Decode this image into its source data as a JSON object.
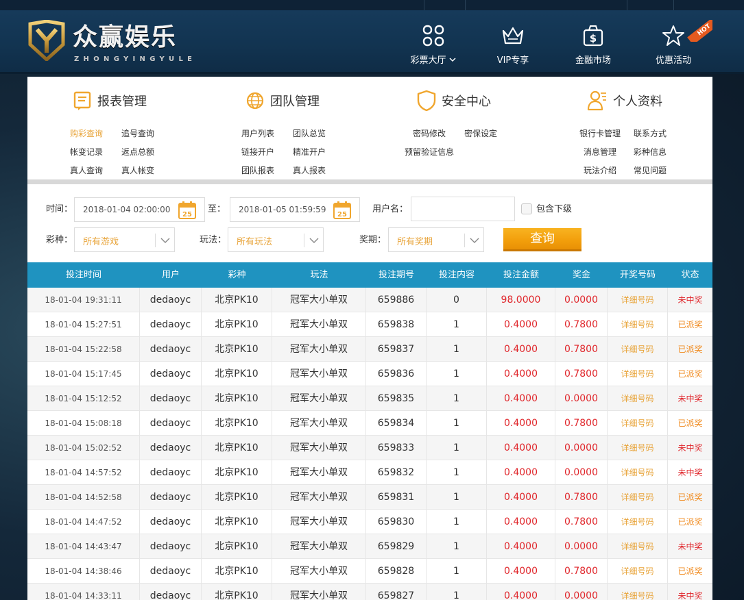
{
  "header": {
    "brand": "众赢娱乐",
    "brand_pinyin": "ZHONGYINGYULE",
    "nav": [
      {
        "label": "彩票大厅",
        "icon": "grid-icon",
        "has_dropdown": true
      },
      {
        "label": "VIP专享",
        "icon": "crown-icon"
      },
      {
        "label": "金融市场",
        "icon": "money-bag-icon"
      },
      {
        "label": "优惠活动",
        "icon": "star-icon"
      }
    ],
    "hot_badge": "HOT"
  },
  "menus": [
    {
      "title": "报表管理",
      "icon": "report-icon",
      "links": [
        "购彩查询",
        "追号查询",
        "帐变记录",
        "返点总额",
        "真人查询",
        "真人帐变"
      ],
      "active": "购彩查询"
    },
    {
      "title": "团队管理",
      "icon": "globe-icon",
      "links": [
        "用户列表",
        "团队总览",
        "链接开户",
        "精准开户",
        "团队报表",
        "真人报表"
      ]
    },
    {
      "title": "安全中心",
      "icon": "shield-icon",
      "links": [
        "密码修改",
        "密保设定",
        "预留验证信息"
      ]
    },
    {
      "title": "个人资料",
      "icon": "user-icon",
      "links": [
        "银行卡管理",
        "联系方式",
        "消息管理",
        "彩种信息",
        "玩法介绍",
        "常见问题"
      ]
    }
  ],
  "filter": {
    "time_label": "时间：",
    "start_time": "2018-01-04 02:00:00",
    "to_label": "至：",
    "end_time": "2018-01-05 01:59:59",
    "calendar_day": "25",
    "username_label": "用户名：",
    "username_value": "",
    "include_sub_label": "包含下级",
    "game_label": "彩种：",
    "game_value": "所有游戏",
    "play_label": "玩法：",
    "play_value": "所有玩法",
    "prize_label": "奖期：",
    "prize_value": "所有奖期",
    "query_label": "查询"
  },
  "table": {
    "headers": [
      "投注时间",
      "用户",
      "彩种",
      "玩法",
      "投注期号",
      "投注内容",
      "投注金额",
      "奖金",
      "开奖号码",
      "状态"
    ],
    "rows": [
      [
        "18-01-04 19:31:11",
        "dedaoyc",
        "北京PK10",
        "冠军大小单双",
        "659886",
        "0",
        "98.0000",
        "0.0000",
        "详细号码",
        "未中奖"
      ],
      [
        "18-01-04 15:27:51",
        "dedaoyc",
        "北京PK10",
        "冠军大小单双",
        "659838",
        "1",
        "0.4000",
        "0.7800",
        "详细号码",
        "已派奖"
      ],
      [
        "18-01-04 15:22:58",
        "dedaoyc",
        "北京PK10",
        "冠军大小单双",
        "659837",
        "1",
        "0.4000",
        "0.7800",
        "详细号码",
        "已派奖"
      ],
      [
        "18-01-04 15:17:45",
        "dedaoyc",
        "北京PK10",
        "冠军大小单双",
        "659836",
        "1",
        "0.4000",
        "0.7800",
        "详细号码",
        "已派奖"
      ],
      [
        "18-01-04 15:12:52",
        "dedaoyc",
        "北京PK10",
        "冠军大小单双",
        "659835",
        "1",
        "0.4000",
        "0.0000",
        "详细号码",
        "未中奖"
      ],
      [
        "18-01-04 15:08:18",
        "dedaoyc",
        "北京PK10",
        "冠军大小单双",
        "659834",
        "1",
        "0.4000",
        "0.7800",
        "详细号码",
        "已派奖"
      ],
      [
        "18-01-04 15:02:52",
        "dedaoyc",
        "北京PK10",
        "冠军大小单双",
        "659833",
        "1",
        "0.4000",
        "0.0000",
        "详细号码",
        "未中奖"
      ],
      [
        "18-01-04 14:57:52",
        "dedaoyc",
        "北京PK10",
        "冠军大小单双",
        "659832",
        "1",
        "0.4000",
        "0.0000",
        "详细号码",
        "未中奖"
      ],
      [
        "18-01-04 14:52:58",
        "dedaoyc",
        "北京PK10",
        "冠军大小单双",
        "659831",
        "1",
        "0.4000",
        "0.7800",
        "详细号码",
        "已派奖"
      ],
      [
        "18-01-04 14:47:52",
        "dedaoyc",
        "北京PK10",
        "冠军大小单双",
        "659830",
        "1",
        "0.4000",
        "0.7800",
        "详细号码",
        "已派奖"
      ],
      [
        "18-01-04 14:43:47",
        "dedaoyc",
        "北京PK10",
        "冠军大小单双",
        "659829",
        "1",
        "0.4000",
        "0.0000",
        "详细号码",
        "未中奖"
      ],
      [
        "18-01-04 14:38:46",
        "dedaoyc",
        "北京PK10",
        "冠军大小单双",
        "659828",
        "1",
        "0.4000",
        "0.7800",
        "详细号码",
        "已派奖"
      ],
      [
        "18-01-04 14:33:11",
        "dedaoyc",
        "北京PK10",
        "冠军大小单双",
        "659827",
        "1",
        "0.4000",
        "0.0000",
        "详细号码",
        "未中奖"
      ]
    ]
  },
  "colors": {
    "accent": "#1f93c0",
    "gold": "#e8a43a",
    "red": "#e0262b",
    "button": "#f29e0b"
  }
}
